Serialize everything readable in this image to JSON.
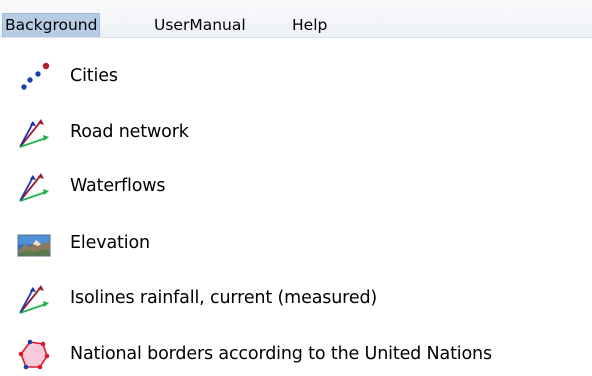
{
  "menubar": {
    "items": [
      {
        "label": "Background",
        "open": true
      },
      {
        "label": "UserManual"
      },
      {
        "label": "Help"
      }
    ]
  },
  "background_menu": {
    "items": [
      {
        "label": "Cities",
        "icon": "points-icon"
      },
      {
        "label": "Road network",
        "icon": "vector-lines-icon"
      },
      {
        "label": "Waterflows",
        "icon": "vector-lines-icon"
      },
      {
        "label": "Elevation",
        "icon": "landscape-raster-icon"
      },
      {
        "label": "Isolines rainfall, current (measured)",
        "icon": "vector-lines-icon"
      },
      {
        "label": "National borders according to the United Nations",
        "icon": "polygon-icon"
      }
    ]
  },
  "colors": {
    "menu_selected_bg": "#b6cce4",
    "point_blue": "#1a3fa8",
    "point_red": "#b01e2a",
    "line_red": "#a01c2c",
    "line_blue": "#1b2fb0",
    "line_green": "#22b34a",
    "polygon_fill": "#f7c9d9",
    "polygon_stroke": "#d81b2e"
  }
}
